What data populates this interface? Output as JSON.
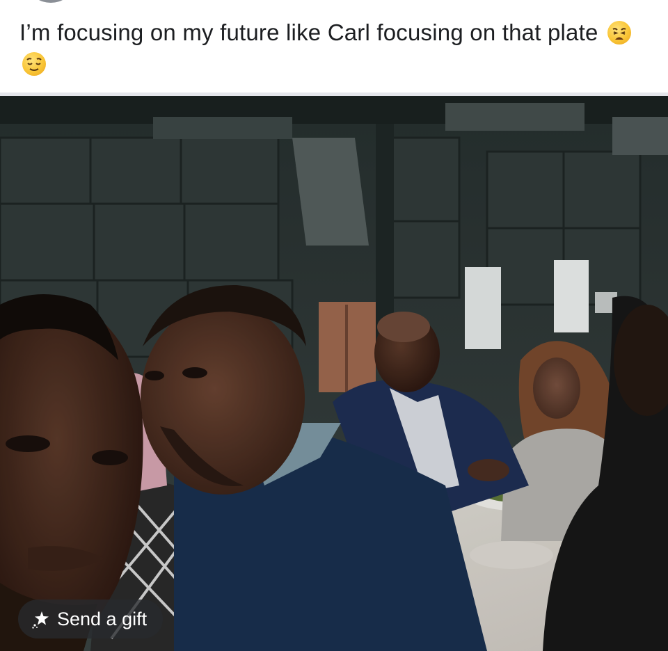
{
  "post": {
    "caption": "I’m focusing on my future like Carl focusing on that plate",
    "emojis": [
      "weary-face-emoji",
      "relieved-face-emoji"
    ]
  },
  "photo": {
    "subject": "group-dinner-photo"
  },
  "gift_button": {
    "label": "Send a gift",
    "icon": "gift-sparkle-icon"
  },
  "colors": {
    "caption_text": "#1c1e21",
    "divider": "#e4e6eb",
    "gift_button_bg": "#2a2c30"
  }
}
